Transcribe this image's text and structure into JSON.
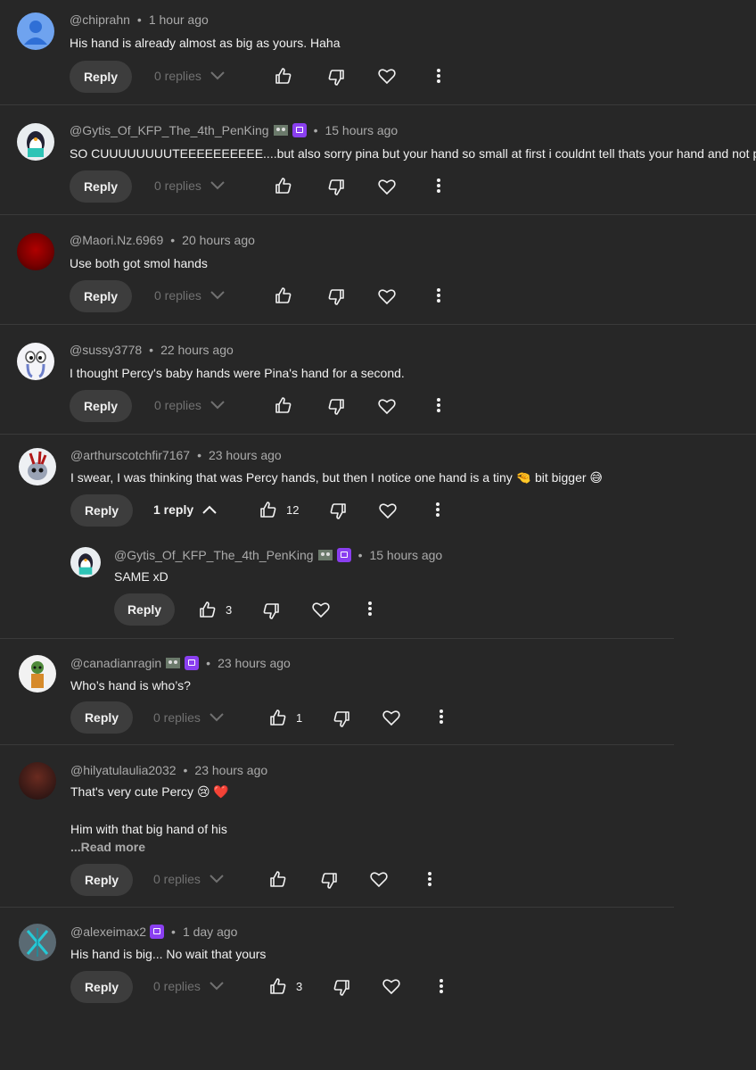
{
  "ui": {
    "reply_label": "Reply",
    "read_more": "...Read more",
    "colors": {
      "background": "#272727",
      "badge": "#8a3ff0",
      "muted": "#aaaaaa"
    }
  },
  "comments": [
    {
      "user": "@chiprahn",
      "time": "1 hour ago",
      "text": "His hand is already almost as big as yours. Haha",
      "replies": "0 replies",
      "likes": ""
    },
    {
      "user": "@Gytis_Of_KFP_The_4th_PenKing",
      "time": "15 hours ago",
      "text": "SO CUUUUUUUUTEEEEEEEEEE....but also sorry pina but your hand so small at first i couldnt tell thats your hand and not percy",
      "replies": "0 replies",
      "likes": ""
    },
    {
      "user": "@Maori.Nz.6969",
      "time": "20 hours ago",
      "text": "Use both got smol hands",
      "replies": "0 replies",
      "likes": ""
    },
    {
      "user": "@sussy3778",
      "time": "22 hours ago",
      "text": "I thought Percy's baby hands were Pina's hand for a second.",
      "replies": "0 replies",
      "likes": ""
    },
    {
      "user": "@arthurscotchfir7167",
      "time": "23 hours ago",
      "text": "I swear, I was thinking that was Percy hands, but then I notice one hand is a tiny 🤏 bit bigger 😅",
      "replies": "1 reply",
      "likes": "12"
    },
    {
      "user": "@Gytis_Of_KFP_The_4th_PenKing",
      "time": "15 hours ago",
      "text": "SAME xD",
      "likes": "3"
    },
    {
      "user": "@canadianragin",
      "time": "23 hours ago",
      "text": "Who’s hand is who’s?",
      "replies": "0 replies",
      "likes": "1"
    },
    {
      "user": "@hilyatulaulia2032",
      "time": "23 hours ago",
      "text": "That's very cute Percy 😢 ❤️",
      "text2": "Him with that big hand of his",
      "replies": "0 replies",
      "likes": ""
    },
    {
      "user": "@alexeimax2",
      "time": "1 day ago",
      "text": "His hand is big... No wait that yours",
      "replies": "0 replies",
      "likes": "3"
    }
  ]
}
